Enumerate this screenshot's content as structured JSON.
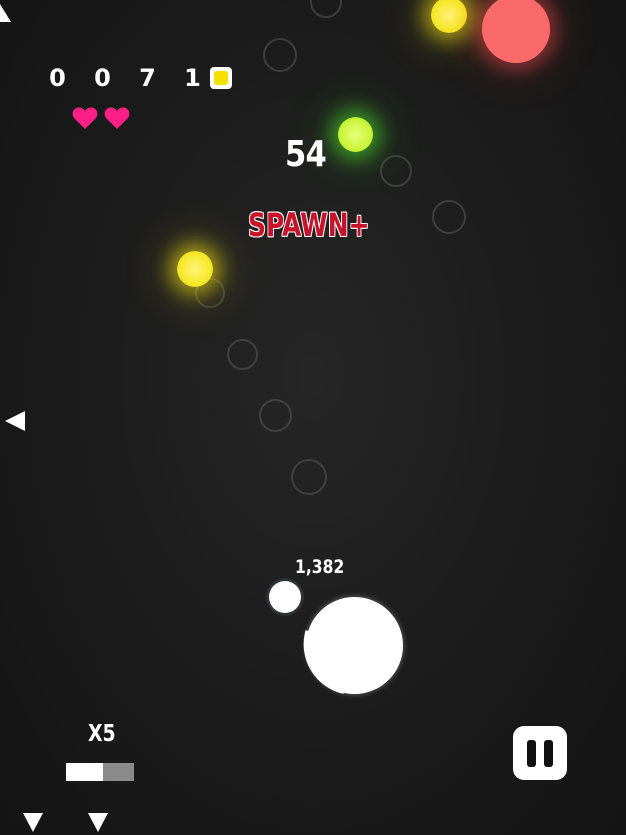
{
  "hud": {
    "score_digits": [
      "0",
      "0",
      "7",
      "1"
    ],
    "coin_icon": "coin-square-icon",
    "lives": 2,
    "heart_color": "#ff1f86"
  },
  "combo": {
    "count": "54"
  },
  "event_text": "SPAWN+",
  "player": {
    "score_label": "1,382",
    "health_fraction": 0.25
  },
  "multiplier": {
    "label": "X5",
    "fill_fraction": 0.55
  },
  "controls": {
    "pause_icon": "pause-icon"
  },
  "edge_indicators": [
    {
      "name": "offscreen-arrow-top-left-icon",
      "direction": "up"
    },
    {
      "name": "offscreen-arrow-left-icon",
      "direction": "left"
    },
    {
      "name": "offscreen-arrow-bottom-left-icon",
      "direction": "down"
    },
    {
      "name": "offscreen-arrow-bottom-icon",
      "direction": "down"
    }
  ],
  "colors": {
    "background": "#1b1b1b",
    "yellow_orb": "#f7ea2f",
    "green_orb": "#c9f53a",
    "red_orb": "#fb6a6a",
    "event_text": "#c8142a"
  }
}
